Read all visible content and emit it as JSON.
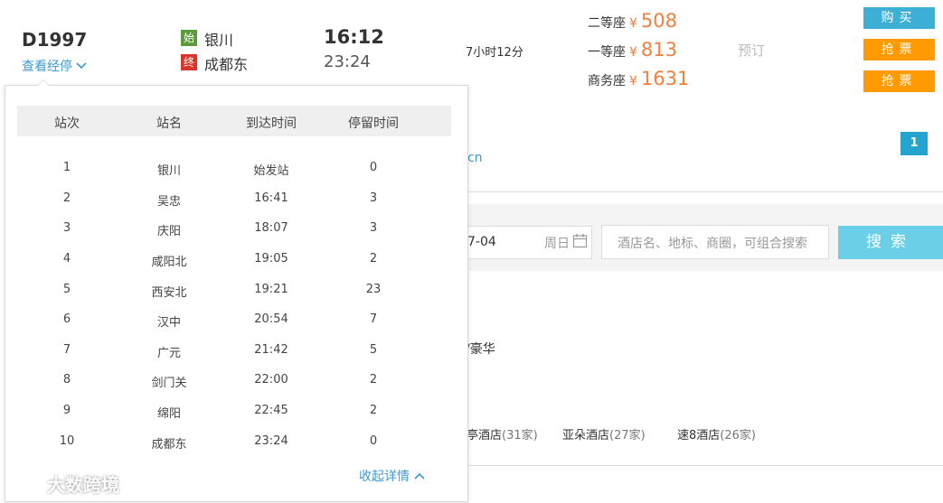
{
  "train": {
    "number": "D1997",
    "stops_link": "查看经停",
    "start_badge": "始",
    "end_badge": "终",
    "from_station": "银川",
    "to_station": "成都东",
    "depart_time": "16:12",
    "arrive_time": "23:24",
    "duration": "7小时12分"
  },
  "seats": [
    {
      "label": "二等座",
      "currency": "¥",
      "price": "508"
    },
    {
      "label": "一等座",
      "currency": "¥",
      "price": "813"
    },
    {
      "label": "商务座",
      "currency": "¥",
      "price": "1631"
    }
  ],
  "reserve_label": "预订",
  "buttons": {
    "buy": "购买",
    "grab1": "抢票",
    "grab2": "抢票",
    "search": "搜索"
  },
  "pagination": {
    "current": "1"
  },
  "fragments": {
    "cn": "cn",
    "date_value": "7-04",
    "date_dow": "周日",
    "hotel_placeholder": "酒店名、地标、商圈，可组合搜索",
    "lux": "/豪华"
  },
  "hotel_chains": [
    {
      "name": "亭酒店",
      "count": "(31家)"
    },
    {
      "name": "亚朵酒店",
      "count": "(27家)"
    },
    {
      "name": "速8酒店",
      "count": "(26家)"
    }
  ],
  "stops_table": {
    "headers": [
      "站次",
      "站名",
      "到达时间",
      "停留时间"
    ],
    "rows": [
      [
        "1",
        "银川",
        "始发站",
        "0"
      ],
      [
        "2",
        "吴忠",
        "16:41",
        "3"
      ],
      [
        "3",
        "庆阳",
        "18:07",
        "3"
      ],
      [
        "4",
        "咸阳北",
        "19:05",
        "2"
      ],
      [
        "5",
        "西安北",
        "19:21",
        "23"
      ],
      [
        "6",
        "汉中",
        "20:54",
        "7"
      ],
      [
        "7",
        "广元",
        "21:42",
        "5"
      ],
      [
        "8",
        "剑门关",
        "22:00",
        "2"
      ],
      [
        "9",
        "绵阳",
        "22:45",
        "2"
      ],
      [
        "10",
        "成都东",
        "23:24",
        "0"
      ]
    ],
    "collapse_label": "收起详情"
  },
  "watermark": "大数跨境",
  "colors": {
    "accent_blue": "#3d9ad1",
    "price_orange": "#f08040",
    "buy_button": "#3bb0d4",
    "grab_button": "#ff9a00",
    "search_button": "#6ccfe8",
    "start_badge": "#5b9a3c",
    "end_badge": "#d9362b"
  }
}
